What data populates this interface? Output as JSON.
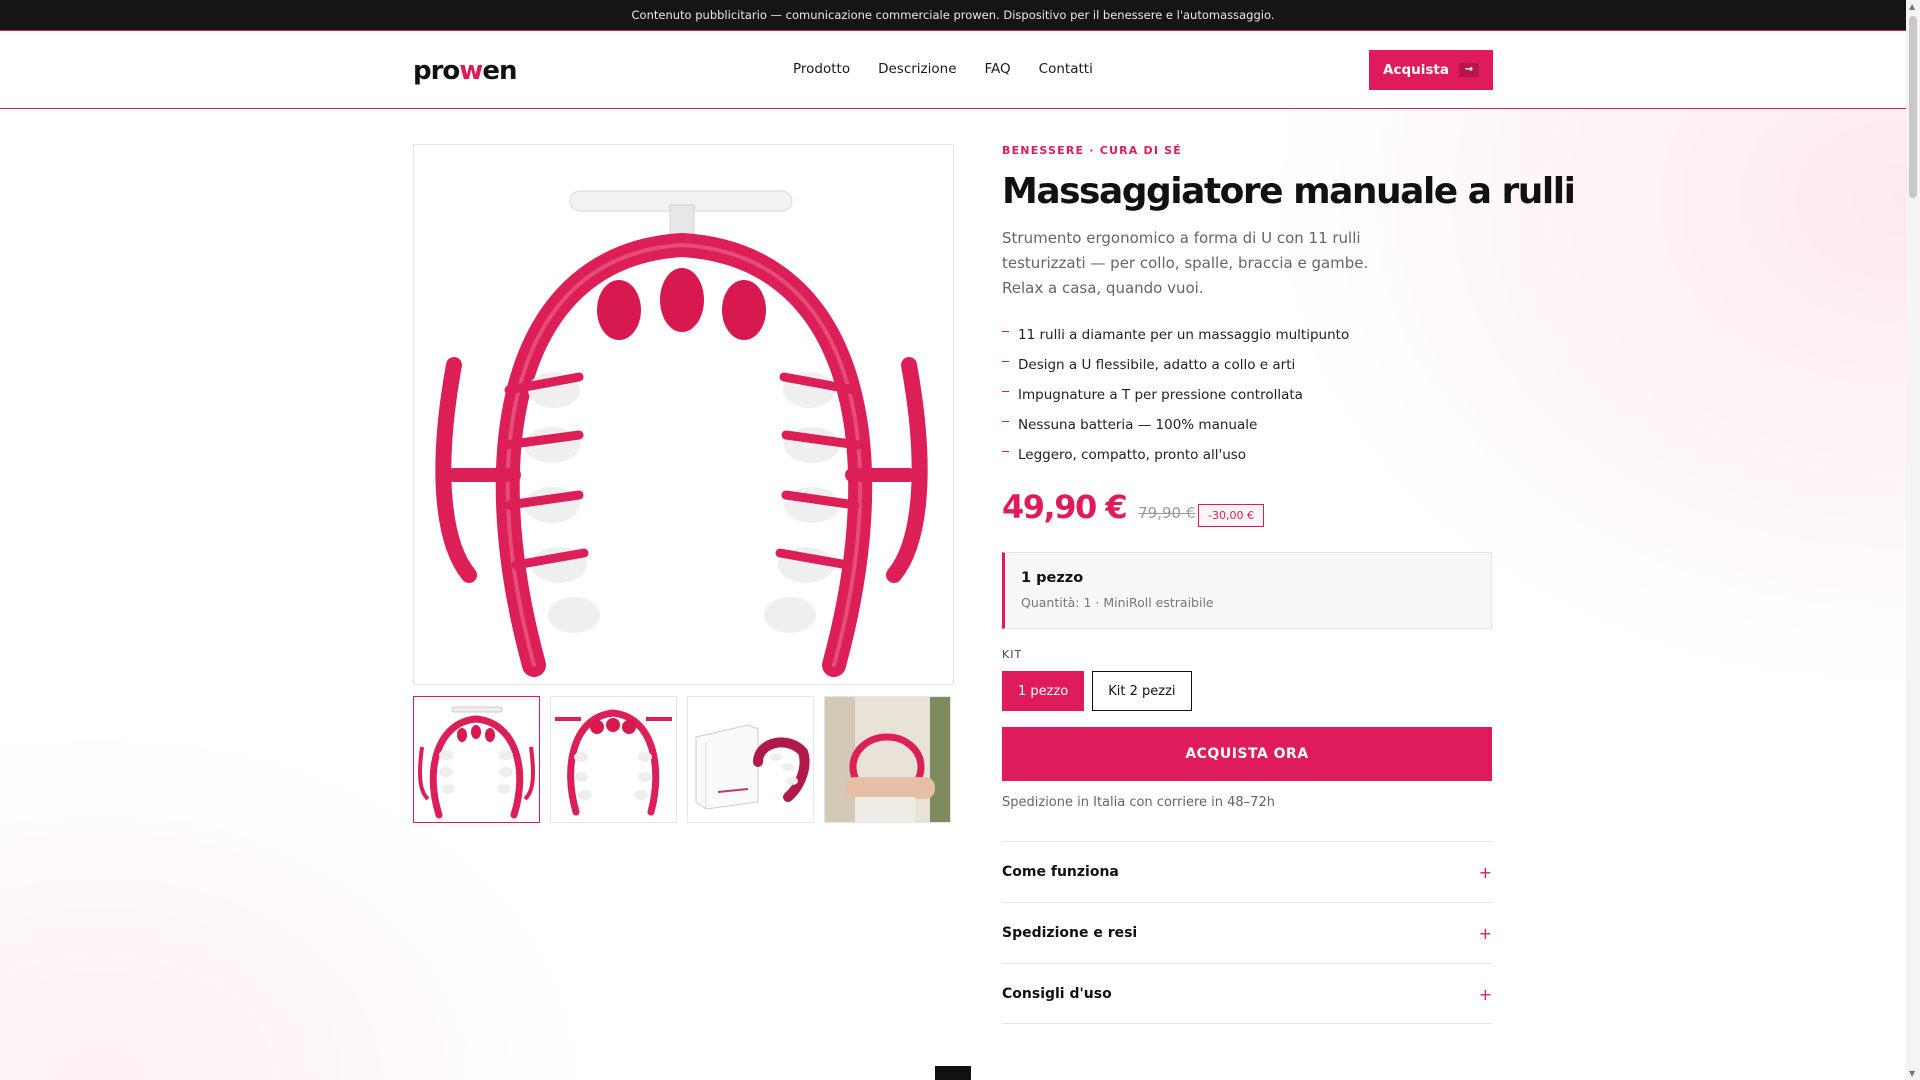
{
  "topbar": {
    "text": "Contenuto pubblicitario — comunicazione commerciale prowen. Dispositivo per il benessere e l'automassaggio."
  },
  "header": {
    "logo_pre": "pro",
    "logo_w": "w",
    "logo_post": "en",
    "nav": [
      "Prodotto",
      "Descrizione",
      "FAQ",
      "Contatti"
    ],
    "cta_label": "Acquista",
    "cta_icon": "→"
  },
  "gallery": {
    "thumbnails": [
      "massager-front-view",
      "massager-top-view",
      "box-and-massager",
      "massager-in-use"
    ],
    "active_index": 0
  },
  "product": {
    "kicker": "BENESSERE · CURA DI SÉ",
    "title": "Massaggiatore manuale a rulli",
    "description": "Strumento ergonomico a forma di U con 11 rulli testurizzati — per collo, spalle, braccia e gambe. Relax a casa, quando vuoi.",
    "bullets": [
      "11 rulli a diamante per un massaggio multipunto",
      "Design a U flessibile, adatto a collo e arti",
      "Impugnature a T per pressione controllata",
      "Nessuna batteria — 100% manuale",
      "Leggero, compatto, pronto all'uso"
    ],
    "price": "49,90 €",
    "old_price": "79,90 €",
    "discount": "-30,00 €",
    "variant_title": "1 pezzo",
    "variant_sub": "Quantità: 1 · MiniRoll estraibile",
    "kit_label": "KIT",
    "kit_options": [
      "1 pezzo",
      "Kit 2 pezzi"
    ],
    "kit_selected": 0,
    "buy_label": "ACQUISTA ORA",
    "shipping": "Spedizione in Italia con corriere in 48–72h"
  },
  "accordion": [
    {
      "title": "Come funziona",
      "icon": "+"
    },
    {
      "title": "Spedizione e resi",
      "icon": "+"
    },
    {
      "title": "Consigli d'uso",
      "icon": "+"
    }
  ],
  "colors": {
    "accent": "#e01b5c",
    "dark": "#151515"
  }
}
